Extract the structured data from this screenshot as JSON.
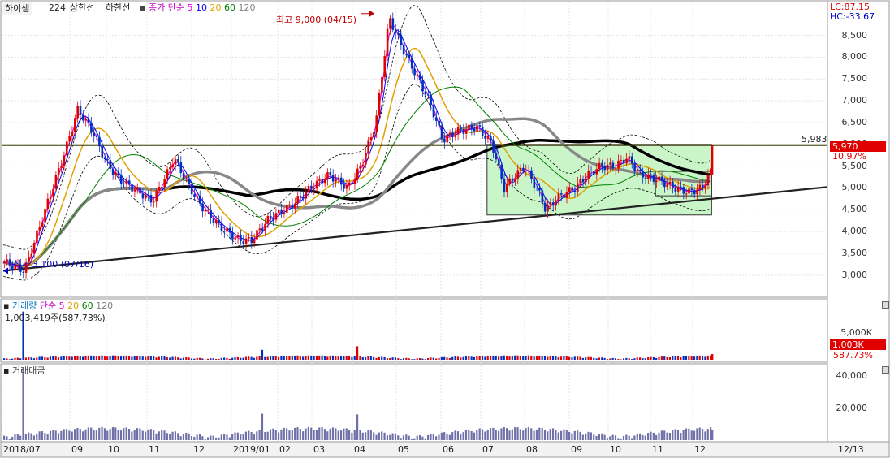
{
  "price_panel": {
    "stock_name": "하이셈",
    "code_text": "224",
    "limit_up": "상한선",
    "limit_down": "하한선",
    "ma_title": "종가 단순",
    "ma_periods": [
      {
        "label": "5",
        "color": "#e000e0"
      },
      {
        "label": "10",
        "color": "#0000ff"
      },
      {
        "label": "20",
        "color": "#e0a000"
      },
      {
        "label": "60",
        "color": "#008000"
      },
      {
        "label": "120",
        "color": "#808080"
      }
    ],
    "lc_text": "LC:87.15",
    "hc_text": "HC:-33.67",
    "max_annotation": "최고 9,000 (04/15)",
    "min_annotation": "최저 3,100 (07/16)",
    "resistance_value": "5,983",
    "current_price": "5,970",
    "current_change": "10.97%",
    "y_ticks": [
      "8,500",
      "8,000",
      "7,500",
      "7,000",
      "6,500",
      "6,000",
      "5,500",
      "5,000",
      "4,500",
      "4,000",
      "3,500",
      "3,000"
    ]
  },
  "volume_panel": {
    "title": "거래량",
    "ma_title": "단순",
    "ma_periods": [
      {
        "label": "5",
        "color": "#e000e0"
      },
      {
        "label": "20",
        "color": "#e0a000"
      },
      {
        "label": "60",
        "color": "#008000"
      },
      {
        "label": "120",
        "color": "#808080"
      }
    ],
    "value_text": "1,003,419주(587.73%)",
    "tick": "5,000K",
    "current": "1,003K",
    "current_pct": "587.73%"
  },
  "amount_panel": {
    "title": "거래대금",
    "ticks": [
      "40,000",
      "20,000"
    ]
  },
  "x_axis": {
    "labels": [
      "2018/07",
      "09",
      "10",
      "11",
      "12",
      "2019/01",
      "02",
      "03",
      "04",
      "05",
      "06",
      "07",
      "08",
      "09",
      "10",
      "11",
      "12"
    ],
    "right_label": "12/13"
  },
  "chart_data": {
    "type": "candlestick",
    "ylim": [
      2550,
      9200
    ],
    "y_ticks": [
      3000,
      3500,
      4000,
      4500,
      5000,
      5500,
      6000,
      6500,
      7000,
      7500,
      8000,
      8500
    ],
    "close_path": [
      [
        "2018-07-01",
        3300
      ],
      [
        "2018-07-16",
        3100
      ],
      [
        "2018-07-25",
        3900
      ],
      [
        "2018-08-05",
        4900
      ],
      [
        "2018-08-15",
        5800
      ],
      [
        "2018-08-25",
        6800
      ],
      [
        "2018-09-05",
        6300
      ],
      [
        "2018-09-15",
        5600
      ],
      [
        "2018-09-25",
        5200
      ],
      [
        "2018-10-05",
        5000
      ],
      [
        "2018-10-20",
        4700
      ],
      [
        "2018-11-01",
        5400
      ],
      [
        "2018-11-05",
        5700
      ],
      [
        "2018-11-15",
        5100
      ],
      [
        "2018-11-25",
        4600
      ],
      [
        "2018-12-10",
        4100
      ],
      [
        "2018-12-24",
        3800
      ],
      [
        "2019-01-02",
        3800
      ],
      [
        "2019-01-15",
        4300
      ],
      [
        "2019-02-01",
        4600
      ],
      [
        "2019-02-15",
        5000
      ],
      [
        "2019-03-01",
        5300
      ],
      [
        "2019-03-15",
        5000
      ],
      [
        "2019-03-25",
        5500
      ],
      [
        "2019-04-05",
        6500
      ],
      [
        "2019-04-15",
        8900
      ],
      [
        "2019-04-25",
        8200
      ],
      [
        "2019-05-05",
        7600
      ],
      [
        "2019-05-15",
        7000
      ],
      [
        "2019-05-25",
        6100
      ],
      [
        "2019-06-05",
        6300
      ],
      [
        "2019-06-20",
        6400
      ],
      [
        "2019-07-01",
        6000
      ],
      [
        "2019-07-10",
        5000
      ],
      [
        "2019-07-25",
        5500
      ],
      [
        "2019-08-05",
        4900
      ],
      [
        "2019-08-10",
        4500
      ],
      [
        "2019-08-20",
        4800
      ],
      [
        "2019-09-01",
        5000
      ],
      [
        "2019-09-10",
        5300
      ],
      [
        "2019-09-20",
        5500
      ],
      [
        "2019-10-01",
        5500
      ],
      [
        "2019-10-10",
        5700
      ],
      [
        "2019-10-20",
        5300
      ],
      [
        "2019-11-01",
        5200
      ],
      [
        "2019-11-15",
        5000
      ],
      [
        "2019-11-25",
        4900
      ],
      [
        "2019-12-05",
        5000
      ],
      [
        "2019-12-12",
        5400
      ],
      [
        "2019-12-13",
        5970
      ]
    ],
    "max_point": {
      "date": "2019-04-15",
      "value": 9000
    },
    "min_point": {
      "date": "2018-07-16",
      "value": 3100
    },
    "last_close": 5970,
    "resistance_level": 5983,
    "volume_ylim_k": [
      0,
      9000
    ],
    "volume_last_k": 1003,
    "amount_ticks": [
      20000,
      40000
    ]
  }
}
